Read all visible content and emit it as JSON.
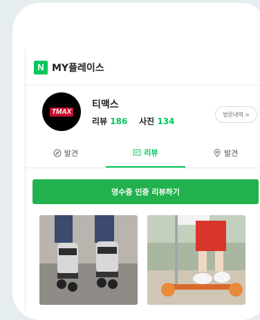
{
  "header": {
    "logo_letter": "N",
    "title": "MY플레이스"
  },
  "profile": {
    "avatar_text": "TMAX",
    "name": "티맥스",
    "review_label": "리뷰",
    "review_count": "186",
    "photo_label": "사진",
    "photo_count": "134",
    "visit_button": "방문내역 >"
  },
  "tabs": [
    {
      "label": "발견",
      "icon": "compass-icon"
    },
    {
      "label": "리뷰",
      "icon": "review-icon"
    },
    {
      "label": "발견",
      "icon": "pin-icon"
    }
  ],
  "actions": {
    "receipt_review": "영수증 인증 리뷰하기"
  },
  "colors": {
    "brand": "#03c75a",
    "button": "#22b14c"
  }
}
